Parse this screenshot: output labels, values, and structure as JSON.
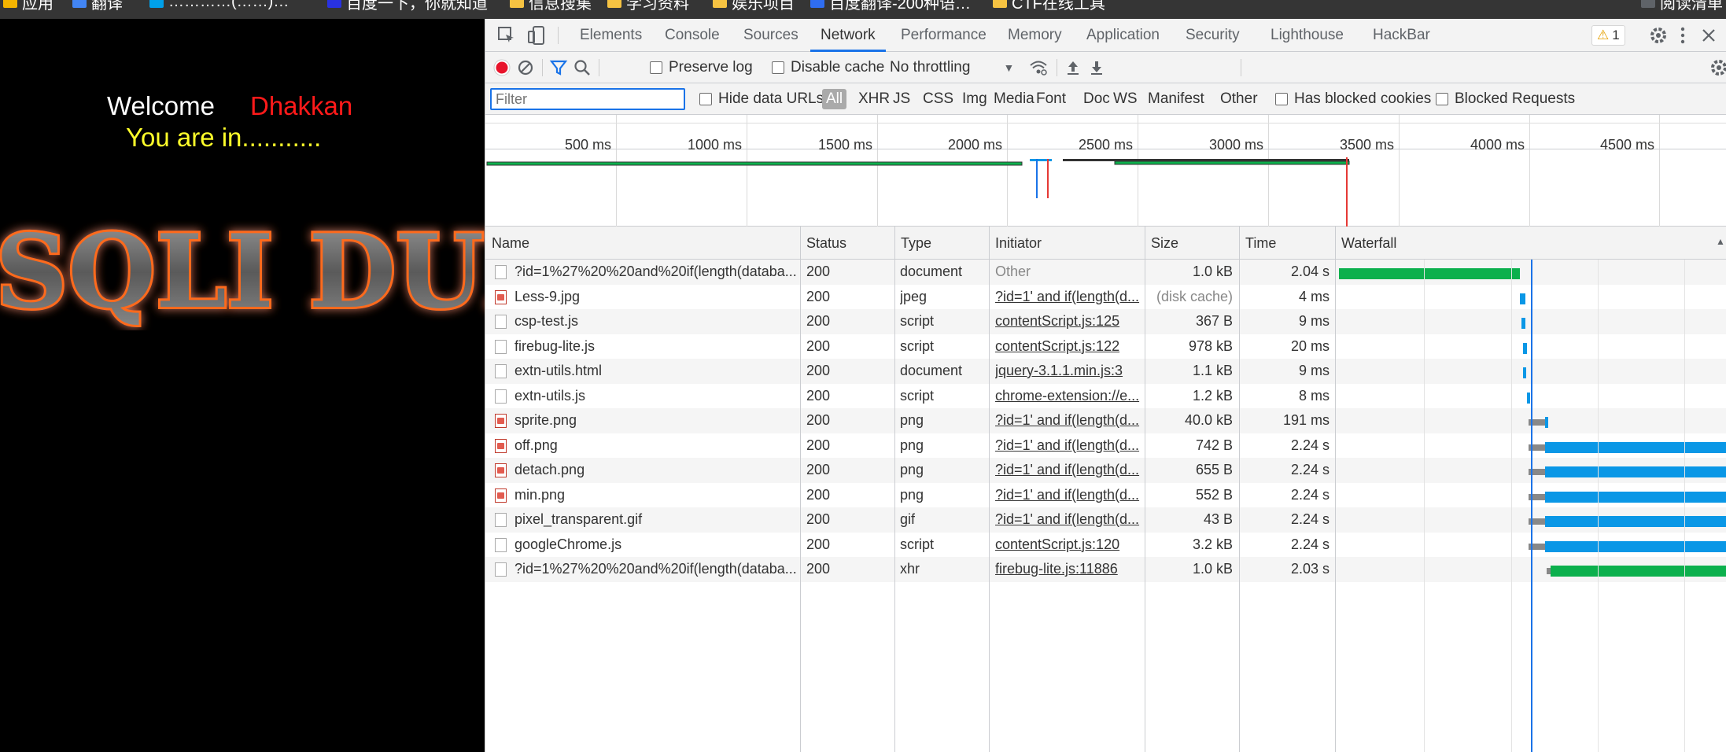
{
  "bookmarks": [
    {
      "label": "应用",
      "icon": "apps-icon",
      "color": "#f4b400"
    },
    {
      "label": "翻译",
      "icon": "translate-icon",
      "color": "#4285f4"
    },
    {
      "label": "…………(……)…",
      "icon": "bookmark-icon",
      "color": "#00a0e9"
    },
    {
      "label": "百度一下，你就知道",
      "icon": "baidu-icon",
      "color": "#2932e1"
    },
    {
      "label": "信息搜集",
      "icon": "folder-icon",
      "color": "#f6c342"
    },
    {
      "label": "学习资料",
      "icon": "folder-icon",
      "color": "#f6c342"
    },
    {
      "label": "娱乐项目",
      "icon": "folder-icon",
      "color": "#f6c342"
    },
    {
      "label": "百度翻译-200种语…",
      "icon": "baidu-translate-icon",
      "color": "#2f6df0"
    },
    {
      "label": "CTF在线工具",
      "icon": "folder-icon",
      "color": "#f6c342"
    },
    {
      "label": "阅读清单",
      "icon": "reading-list-icon",
      "color": "#5f6368"
    }
  ],
  "page": {
    "welcome": "Welcome",
    "username": "Dhakkan",
    "status": "You are in...........",
    "logo_text": "SQLI DUMB"
  },
  "devtools": {
    "tabs": [
      "Elements",
      "Console",
      "Sources",
      "Network",
      "Performance",
      "Memory",
      "Application",
      "Security",
      "Lighthouse",
      "HackBar"
    ],
    "active_tab": "Network",
    "warning_count": "1",
    "toolbar": {
      "preserve_log": "Preserve log",
      "disable_cache": "Disable cache",
      "throttling": "No throttling"
    },
    "filter": {
      "placeholder": "Filter",
      "hide_data_urls": "Hide data URLs",
      "types": [
        "All",
        "XHR",
        "JS",
        "CSS",
        "Img",
        "Media",
        "Font",
        "Doc",
        "WS",
        "Manifest",
        "Other"
      ],
      "has_blocked_cookies": "Has blocked cookies",
      "blocked_requests": "Blocked Requests"
    },
    "overview_ticks": [
      "500 ms",
      "1000 ms",
      "1500 ms",
      "2000 ms",
      "2500 ms",
      "3000 ms",
      "3500 ms",
      "4000 ms",
      "4500 ms"
    ],
    "columns": [
      "Name",
      "Status",
      "Type",
      "Initiator",
      "Size",
      "Time",
      "Waterfall"
    ],
    "requests": [
      {
        "name": "?id=1%27%20%20and%20if(length(databa...",
        "status": "200",
        "type": "document",
        "initiator": "Other",
        "size": "1.0 kB",
        "time": "2.04 s",
        "icon": "doc-file-icon",
        "wait_start": 0,
        "start": 0.02,
        "end": 1.03,
        "bar": "#0cb04d"
      },
      {
        "name": "Less-9.jpg",
        "status": "200",
        "type": "jpeg",
        "initiator": "?id=1' and if(length(d...",
        "size": "(disk cache)",
        "time": "4 ms",
        "icon": "image-file-icon",
        "wait_start": 0,
        "start": 1.03,
        "end": 1.06,
        "bar": "#0a97e6"
      },
      {
        "name": "csp-test.js",
        "status": "200",
        "type": "script",
        "initiator": "contentScript.js:125",
        "size": "367 B",
        "time": "9 ms",
        "icon": "file-icon",
        "wait_start": 0,
        "start": 1.04,
        "end": 1.06,
        "bar": "#0a97e6"
      },
      {
        "name": "firebug-lite.js",
        "status": "200",
        "type": "script",
        "initiator": "contentScript.js:122",
        "size": "978 kB",
        "time": "20 ms",
        "icon": "file-icon",
        "wait_start": 0,
        "start": 1.05,
        "end": 1.07,
        "bar": "#0a97e6"
      },
      {
        "name": "extn-utils.html",
        "status": "200",
        "type": "document",
        "initiator": "jquery-3.1.1.min.js:3",
        "size": "1.1 kB",
        "time": "9 ms",
        "icon": "file-icon",
        "wait_start": 0,
        "start": 1.05,
        "end": 1.06,
        "bar": "#0a97e6"
      },
      {
        "name": "extn-utils.js",
        "status": "200",
        "type": "script",
        "initiator": "chrome-extension://e...",
        "size": "1.2 kB",
        "time": "8 ms",
        "icon": "file-icon",
        "wait_start": 0,
        "start": 1.07,
        "end": 1.08,
        "bar": "#0a97e6"
      },
      {
        "name": "sprite.png",
        "status": "200",
        "type": "png",
        "initiator": "?id=1' and if(length(d...",
        "size": "40.0 kB",
        "time": "191 ms",
        "icon": "image-file-icon",
        "wait_start": 1.08,
        "start": 1.17,
        "end": 1.19,
        "bar": "#0a97e6"
      },
      {
        "name": "off.png",
        "status": "200",
        "type": "png",
        "initiator": "?id=1' and if(length(d...",
        "size": "742 B",
        "time": "2.24 s",
        "icon": "image-file-icon",
        "wait_start": 1.08,
        "start": 1.17,
        "end": 2.5,
        "bar": "#0a97e6"
      },
      {
        "name": "detach.png",
        "status": "200",
        "type": "png",
        "initiator": "?id=1' and if(length(d...",
        "size": "655 B",
        "time": "2.24 s",
        "icon": "image-file-icon",
        "wait_start": 1.08,
        "start": 1.17,
        "end": 2.5,
        "bar": "#0a97e6"
      },
      {
        "name": "min.png",
        "status": "200",
        "type": "png",
        "initiator": "?id=1' and if(length(d...",
        "size": "552 B",
        "time": "2.24 s",
        "icon": "image-file-icon",
        "wait_start": 1.08,
        "start": 1.17,
        "end": 2.5,
        "bar": "#0a97e6"
      },
      {
        "name": "pixel_transparent.gif",
        "status": "200",
        "type": "gif",
        "initiator": "?id=1' and if(length(d...",
        "size": "43 B",
        "time": "2.24 s",
        "icon": "file-icon",
        "wait_start": 1.08,
        "start": 1.17,
        "end": 2.5,
        "bar": "#0a97e6"
      },
      {
        "name": "googleChrome.js",
        "status": "200",
        "type": "script",
        "initiator": "contentScript.js:120",
        "size": "3.2 kB",
        "time": "2.24 s",
        "icon": "file-icon",
        "wait_start": 1.08,
        "start": 1.17,
        "end": 2.5,
        "bar": "#0a97e6"
      },
      {
        "name": "?id=1%27%20%20and%20if(length(databa...",
        "status": "200",
        "type": "xhr",
        "initiator": "firebug-lite.js:11886",
        "size": "1.0 kB",
        "time": "2.03 s",
        "icon": "file-icon",
        "wait_start": 1.18,
        "start": 1.2,
        "end": 2.5,
        "bar": "#0cb04d"
      }
    ]
  }
}
